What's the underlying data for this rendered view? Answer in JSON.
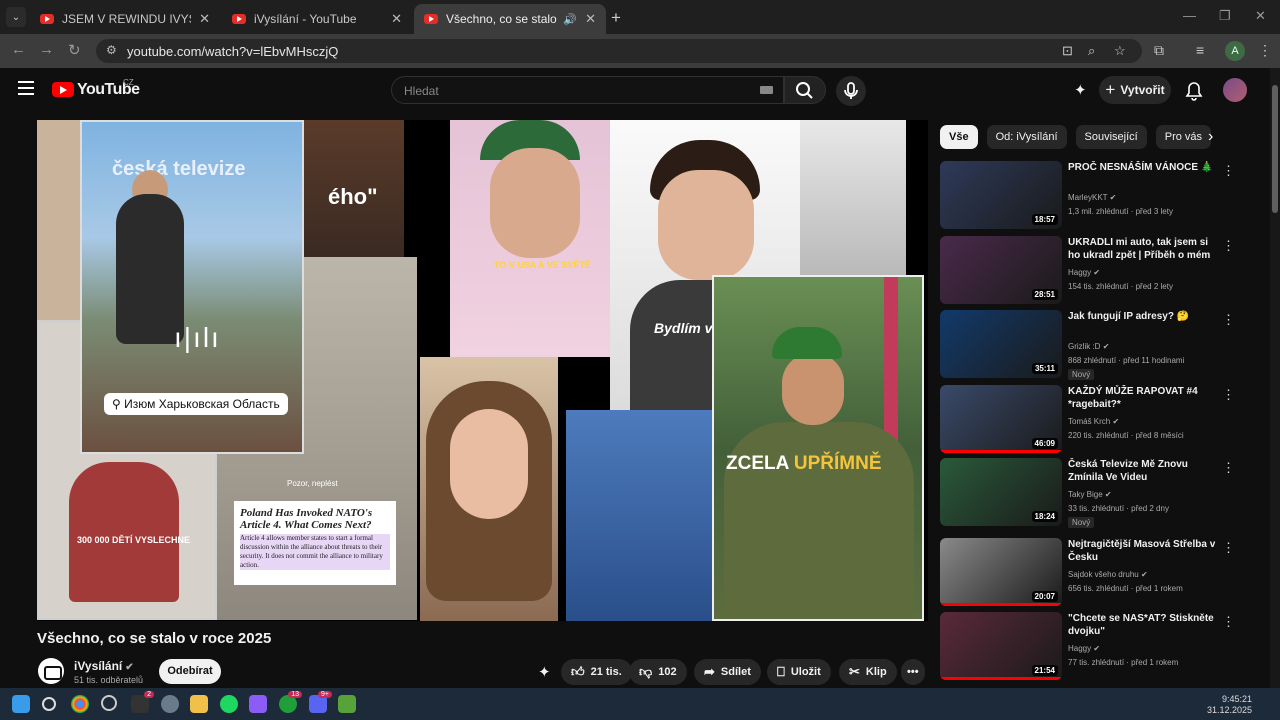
{
  "browser": {
    "tabs": [
      {
        "title": "JSEM V REWINDU IVYSÍLÁNÍ!!! -",
        "active": false
      },
      {
        "title": "iVysílání - YouTube",
        "active": false
      },
      {
        "title": "Všechno, co se stalo v roce",
        "active": true
      }
    ],
    "url": "youtube.com/watch?v=lEbvMHsczjQ",
    "profile_initial": "A"
  },
  "header": {
    "logo_text": "YouTube",
    "country_code": "CZ",
    "search_placeholder": "Hledat",
    "create_label": "Vytvořit"
  },
  "player_overlays": {
    "ct_logo": "česká televize",
    "location_tag": "Изюм Харьковская Область",
    "eho_text": "ého\"",
    "left_caption": "300 000 DĚTÍ VYSLECHNE",
    "pozor_text": "Pozor, neplést",
    "poland_headline": "Poland Has Invoked NATO's Article 4. What Comes Next?",
    "poland_body": "Article 4 allows member states to start a formal discussion within the alliance about threats to their security. It does not commit the alliance to military action.",
    "guy1_caption": "TO V USA A VE SVĚTĚ",
    "guy2_caption": "Bydlím v",
    "soldier_caption_a": "ZCELA ",
    "soldier_caption_b": "UPŘÍMNĚ"
  },
  "video": {
    "title": "Všechno, co se stalo v roce 2025",
    "channel": "iVysílání",
    "subscribers": "51 tis. odběratelů",
    "subscribe_label": "Odebírat",
    "likes": "21 tis.",
    "dislikes": "102",
    "share_label": "Sdílet",
    "save_label": "Uložit",
    "clip_label": "Klip",
    "more_label": "•••"
  },
  "chips": [
    "Vše",
    "Od: iVysílání",
    "Související",
    "Pro vás"
  ],
  "recommendations": [
    {
      "title": "PROČ NESNÁŠÍM VÁNOCE 🎄",
      "channel": "MarleyKKT",
      "meta": "1,3 mil. zhlédnutí · před 3 lety",
      "duration": "18:57",
      "badge": "",
      "progress": 0,
      "thumb": "#2e3a5a"
    },
    {
      "title": "UKRADLI mi auto, tak jsem si ho ukradl zpět | Příběh o mém ...",
      "channel": "Haggy",
      "meta": "154 tis. zhlédnutí · před 2 lety",
      "duration": "28:51",
      "badge": "",
      "progress": 0,
      "thumb": "#4a2a4a"
    },
    {
      "title": "Jak fungují IP adresy? 🤔",
      "channel": "Grizlik :D",
      "meta": "868 zhlédnutí · před 11 hodinami",
      "duration": "35:11",
      "badge": "Nový",
      "progress": 0,
      "thumb": "#123a6b"
    },
    {
      "title": "KAŽDÝ MŮŽE RAPOVAT #4 *ragebait?*",
      "channel": "Tomáš Krch",
      "meta": "220 tis. zhlédnutí · před 8 měsíci",
      "duration": "46:09",
      "badge": "",
      "progress": 1.0,
      "thumb": "#3a4a6a"
    },
    {
      "title": "Česká Televize Mě Znovu Zmínila Ve Videu",
      "channel": "Taky Bige",
      "meta": "33 tis. zhlédnutí · před 2 dny",
      "duration": "18:24",
      "badge": "Nový",
      "progress": 0,
      "thumb": "#2a5a3a"
    },
    {
      "title": "Nejtragičtější Masová Střelba v Česku",
      "channel": "Sajdok všeho druhu",
      "meta": "656 tis. zhlédnutí · před 1 rokem",
      "duration": "20:07",
      "badge": "",
      "progress": 1.0,
      "thumb": "#8a8a8a"
    },
    {
      "title": "\"Chcete se NAS*AT? Stiskněte dvojku\"",
      "channel": "Haggy",
      "meta": "77 tis. zhlédnutí · před 1 rokem",
      "duration": "21:54",
      "badge": "",
      "progress": 1.0,
      "thumb": "#5a2a3a"
    }
  ],
  "taskbar": {
    "time": "9:45:21",
    "date": "31.12.2025",
    "badges": [
      "2",
      "13",
      "9+"
    ]
  }
}
